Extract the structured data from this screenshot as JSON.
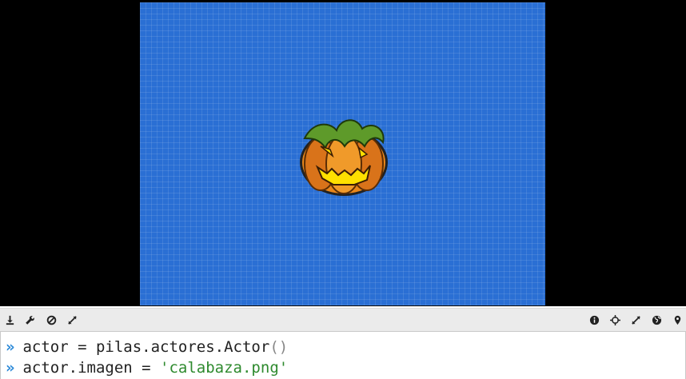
{
  "toolbar": {
    "left_icons": [
      "download-icon",
      "wrench-icon",
      "cancel-icon",
      "expand-icon"
    ],
    "right_icons": [
      "info-icon",
      "move-icon",
      "expand-icon",
      "globe-icon",
      "map-marker-icon"
    ]
  },
  "console": {
    "prompt": "»",
    "lines": [
      {
        "code": "actor = pilas.actores.Actor",
        "paren": "()"
      },
      {
        "code": "actor.imagen = ",
        "string": "'calabaza.png'"
      }
    ]
  },
  "colors": {
    "canvas_bg": "#2a6fd4",
    "prompt": "#2d8ad8",
    "string": "#2e8a2e",
    "letterbox": "#000000"
  }
}
